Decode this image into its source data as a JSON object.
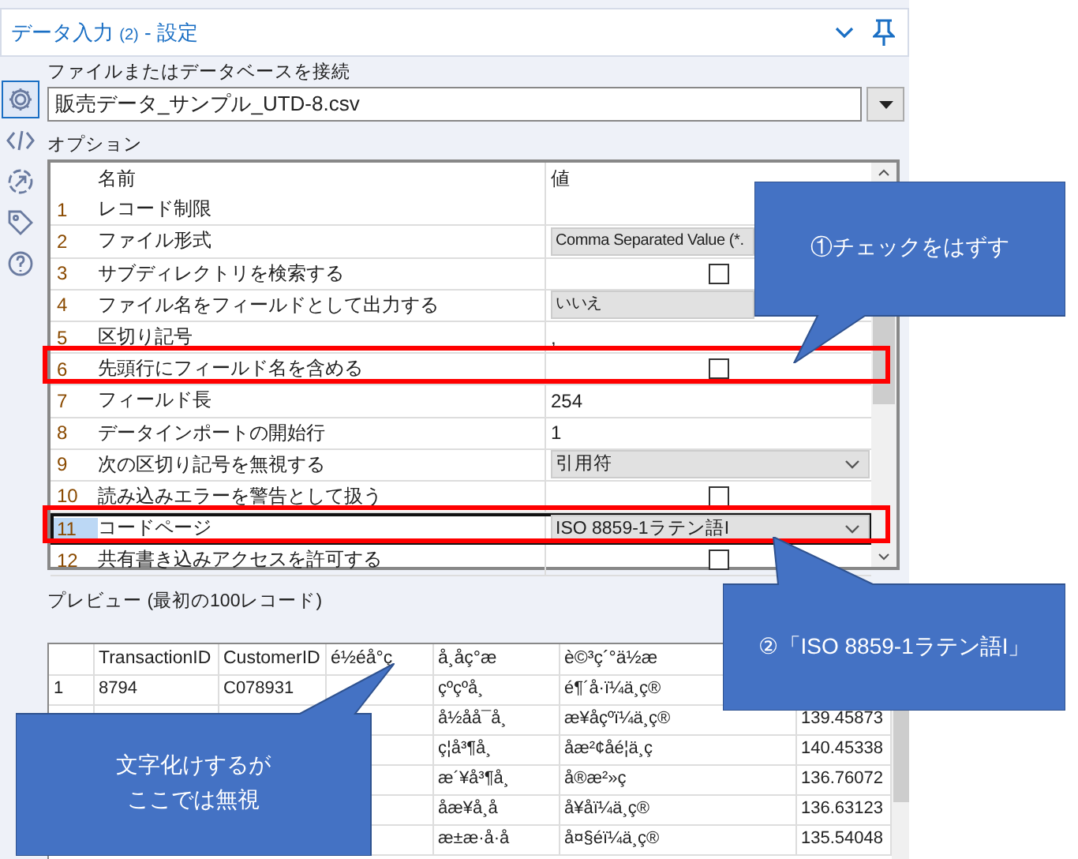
{
  "panel": {
    "title": "データ入力",
    "count": "(2)",
    "suffix": "- 設定"
  },
  "sidebar": [
    {
      "kind": "gear",
      "selected": true
    },
    {
      "kind": "code",
      "selected": false
    },
    {
      "kind": "arrow",
      "selected": false
    },
    {
      "kind": "tag",
      "selected": false
    },
    {
      "kind": "help",
      "selected": false
    }
  ],
  "connect_label": "ファイルまたはデータベースを接続",
  "file_path": "販売データ_サンプル_UTD-8.csv",
  "options_label": "オプション",
  "grid": {
    "columns": [
      "名前",
      "値"
    ],
    "rows": [
      {
        "num": "1",
        "name": "レコード制限",
        "kind": "empty",
        "selected": false,
        "highlighted": false
      },
      {
        "num": "2",
        "name": "ファイル形式",
        "kind": "select",
        "value": "Comma Separated Value (*.",
        "selected": false,
        "highlighted": false
      },
      {
        "num": "3",
        "name": "サブディレクトリを検索する",
        "kind": "checkbox",
        "checked": false,
        "selected": false,
        "highlighted": false
      },
      {
        "num": "4",
        "name": "ファイル名をフィールドとして出力する",
        "kind": "select",
        "value": "いいえ",
        "selected": false,
        "highlighted": false
      },
      {
        "num": "5",
        "name": "区切り記号",
        "kind": "text",
        "value": ",",
        "selected": false,
        "highlighted": false
      },
      {
        "num": "6",
        "name": "先頭行にフィールド名を含める",
        "kind": "checkbox",
        "checked": false,
        "selected": false,
        "highlighted": true
      },
      {
        "num": "7",
        "name": "フィールド長",
        "kind": "text",
        "value": "254",
        "selected": false,
        "highlighted": false
      },
      {
        "num": "8",
        "name": "データインポートの開始行",
        "kind": "text",
        "value": "1",
        "selected": false,
        "highlighted": false
      },
      {
        "num": "9",
        "name": "次の区切り記号を無視する",
        "kind": "dropdown",
        "value": "引用符",
        "selected": false,
        "highlighted": false
      },
      {
        "num": "10",
        "name": "読み込みエラーを警告として扱う",
        "kind": "checkbox",
        "checked": false,
        "selected": false,
        "highlighted": false
      },
      {
        "num": "11",
        "name": "コードページ",
        "kind": "dropdown",
        "value": "ISO 8859-1ラテン語I",
        "selected": true,
        "highlighted": true
      },
      {
        "num": "12",
        "name": "共有書き込みアクセスを許可する",
        "kind": "checkbox",
        "checked": false,
        "selected": false,
        "highlighted": false
      }
    ]
  },
  "preview_label": "プレビュー (最初の100レコード)",
  "preview": {
    "columns": [
      "",
      "TransactionID",
      "CustomerID",
      "é½éå°ç",
      "å¸åç°æ",
      "è©³ç´°ä½æ",
      ""
    ],
    "rows": [
      [
        "1",
        "8794",
        "C078931",
        "",
        "çºçºå¸",
        "é¶´å·ï¼ä¸ç®",
        ""
      ],
      [
        "",
        "",
        "",
        "",
        "å½åå¯å¸",
        "æ¥åçºï¼ä¸ç®",
        "139.45873"
      ],
      [
        "",
        "",
        "",
        "",
        "ç¦å³¶å¸",
        "åæ²¢åé¦ä¸ç",
        "140.45338"
      ],
      [
        "",
        "",
        "",
        "",
        "æ´¥å³¶å¸",
        "å®æ²»ç",
        "136.76072"
      ],
      [
        "",
        "",
        "",
        "",
        "åæ¥å¸å",
        "å¥åï¼ä¸ç®",
        "136.63123"
      ],
      [
        "",
        "",
        "",
        "",
        "æ±æ·å·å",
        "å¤§éï¼ä¸ç®",
        "135.54048"
      ]
    ]
  },
  "callouts": [
    {
      "kind": "right",
      "lines": [
        "①チェックをはずす"
      ]
    },
    {
      "kind": "right2",
      "lines": [
        "②「ISO 8859-1ラテン語I」"
      ]
    },
    {
      "kind": "left",
      "lines": [
        "文字化けするが",
        "ここでは無視"
      ]
    }
  ]
}
